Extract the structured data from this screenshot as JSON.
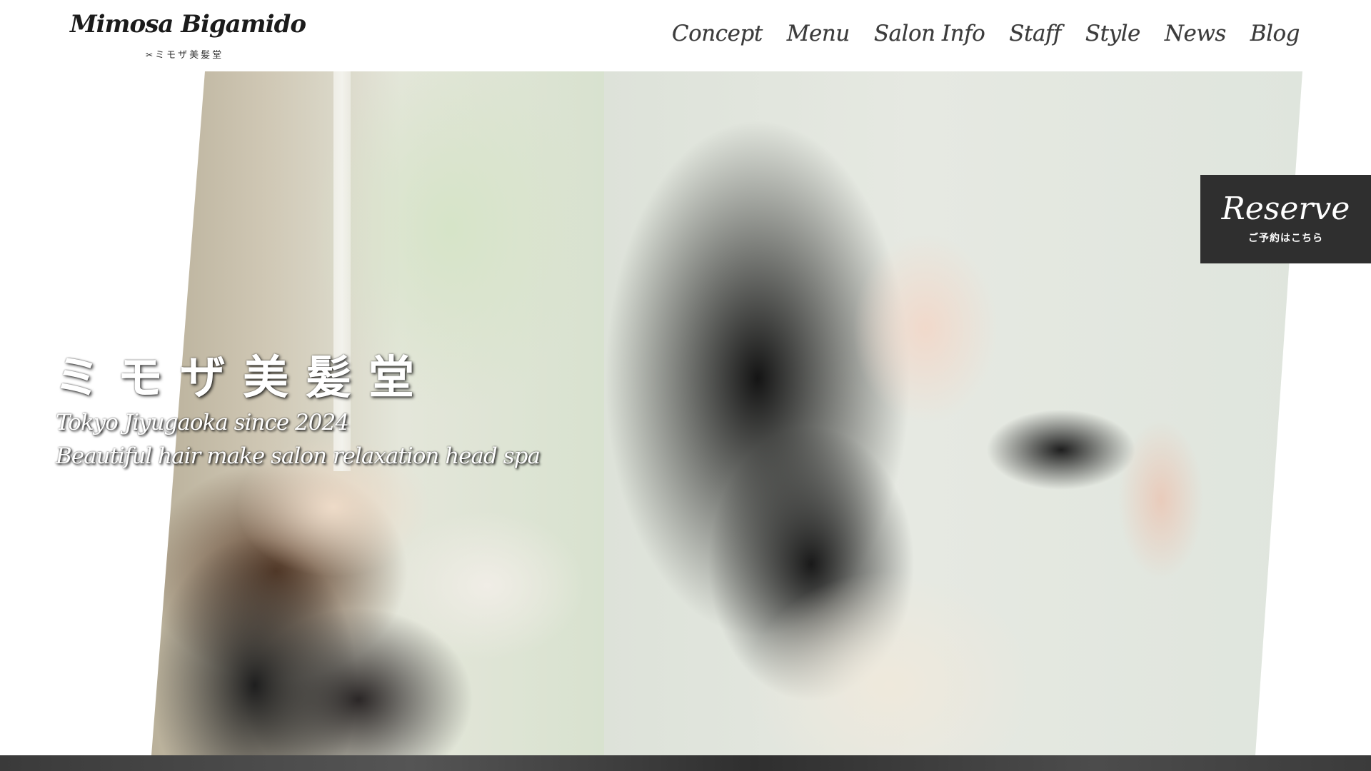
{
  "logo": {
    "name": "Mimosa Bigamido",
    "subtitle": "ミモザ美髪堂"
  },
  "nav": {
    "items": [
      {
        "label": "Concept"
      },
      {
        "label": "Menu"
      },
      {
        "label": "Salon Info"
      },
      {
        "label": "Staff"
      },
      {
        "label": "Style"
      },
      {
        "label": "News"
      },
      {
        "label": "Blog"
      }
    ]
  },
  "hero": {
    "title": "ミモザ美髪堂",
    "line1": "Tokyo Jiyugaoka since 2024",
    "line2": "Beautiful hair make salon relaxation head spa"
  },
  "reserve": {
    "title": "Reserve",
    "subtitle": "ご予約はこちら"
  },
  "colors": {
    "reserve_bg": "#2f2f2f",
    "nav_text": "#3c3c3c",
    "hero_text": "#ffffff"
  }
}
